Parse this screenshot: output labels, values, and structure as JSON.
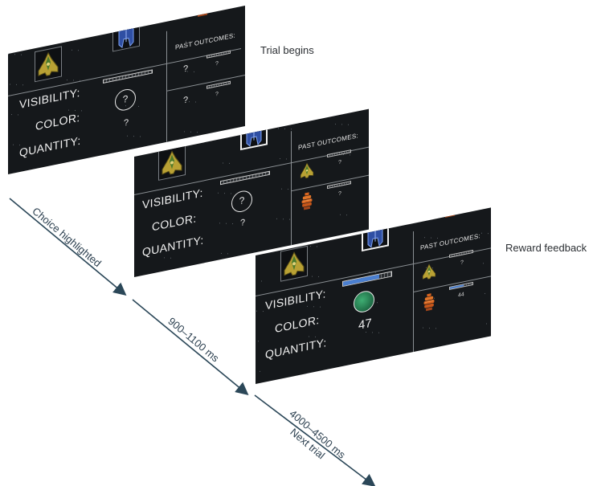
{
  "captions": {
    "trial_begins": "Trial begins",
    "reward_feedback": "Reward feedback"
  },
  "timeline": {
    "segment1": "Choice highlighted",
    "segment2": "900–1100 ms",
    "segment3_line1": "4000–4500 ms",
    "segment3_line2": "Next trial",
    "arrow_color": "#2b4758"
  },
  "screen": {
    "visibility": "VISIBILITY:",
    "color": "COLOR:",
    "quantity": "QUANTITY:",
    "past_outcomes": "PAST OUTCOMES:",
    "unknown": "?"
  },
  "screen1": {
    "quantity_value": "?",
    "past": [
      "?",
      "?"
    ],
    "past_small": [
      "?",
      "?"
    ]
  },
  "screen2": {
    "quantity_value": "?",
    "past_small": [
      "?",
      "?"
    ]
  },
  "screen3": {
    "quantity_value": "47",
    "visibility_level": 0.75,
    "past_small": [
      "?",
      "44"
    ],
    "past_bar_level": 0.6,
    "orb_color": "#2e8f5c"
  },
  "ships": [
    "yellow-fighter-icon",
    "blue-cruiser-icon",
    "orange-tower-icon"
  ],
  "colors": {
    "yellow": "#c8b23a",
    "blue": "#3a66c9",
    "orange": "#d9641f",
    "screen_bg": "#15181b"
  }
}
